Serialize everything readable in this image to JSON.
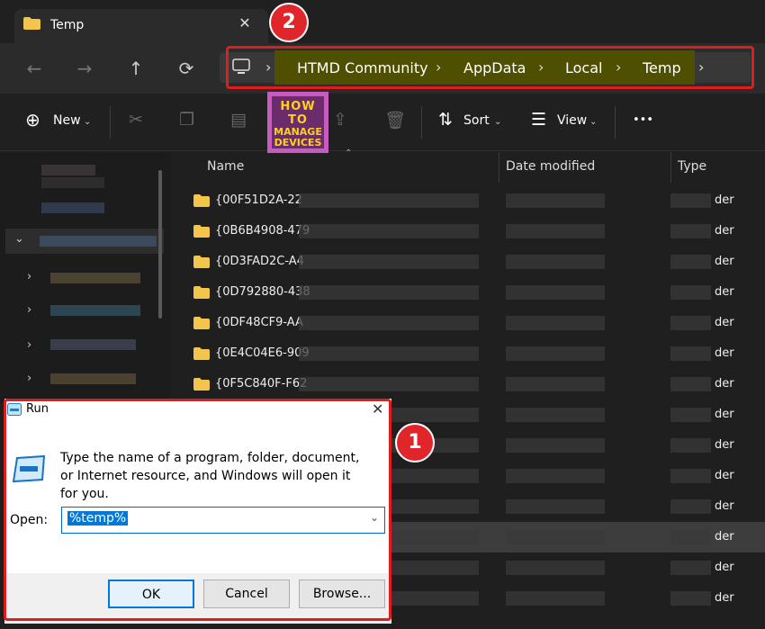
{
  "tab": {
    "title": "Temp",
    "close": "✕"
  },
  "nav": {
    "back": "←",
    "forward": "→",
    "up": "↑",
    "refresh": "⟳",
    "breadcrumb": [
      "HTMD Community",
      "AppData",
      "Local",
      "Temp"
    ]
  },
  "annotations": {
    "badge1": "1",
    "badge2": "2"
  },
  "commands": {
    "new": "New",
    "sort": "Sort",
    "view": "View",
    "more": "•••"
  },
  "logo": {
    "line1": "HOW TO",
    "line2": "MANAGE",
    "line3": "DEVICES"
  },
  "columns": {
    "name": "Name",
    "date": "Date modified",
    "type": "Type"
  },
  "files": [
    {
      "name": "{00F51D2A-22",
      "type": "der"
    },
    {
      "name": "{0B6B4908-479",
      "type": "der"
    },
    {
      "name": "{0D3FAD2C-A4",
      "type": "der"
    },
    {
      "name": "{0D792880-438",
      "type": "der"
    },
    {
      "name": "{0DF48CF9-AA",
      "type": "der"
    },
    {
      "name": "{0E4C04E6-909",
      "type": "der"
    },
    {
      "name": "{0F5C840F-F62",
      "type": "der"
    },
    {
      "name": "",
      "type": "der"
    },
    {
      "name": "",
      "type": "der"
    },
    {
      "name": "",
      "type": "der"
    },
    {
      "name": "",
      "type": "der"
    },
    {
      "name": "",
      "type": "der"
    },
    {
      "name": "",
      "type": "der"
    },
    {
      "name": "",
      "type": "der"
    }
  ],
  "run": {
    "title": "Run",
    "close": "✕",
    "message": "Type the name of a program, folder, document, or Internet resource, and Windows will open it for you.",
    "open_label": "Open:",
    "open_value": "%temp%",
    "ok": "OK",
    "cancel": "Cancel",
    "browse": "Browse..."
  },
  "colors": {
    "accent": "#0078d7",
    "highlight": "#e01d1d",
    "logo_bg": "#c85bbf"
  }
}
